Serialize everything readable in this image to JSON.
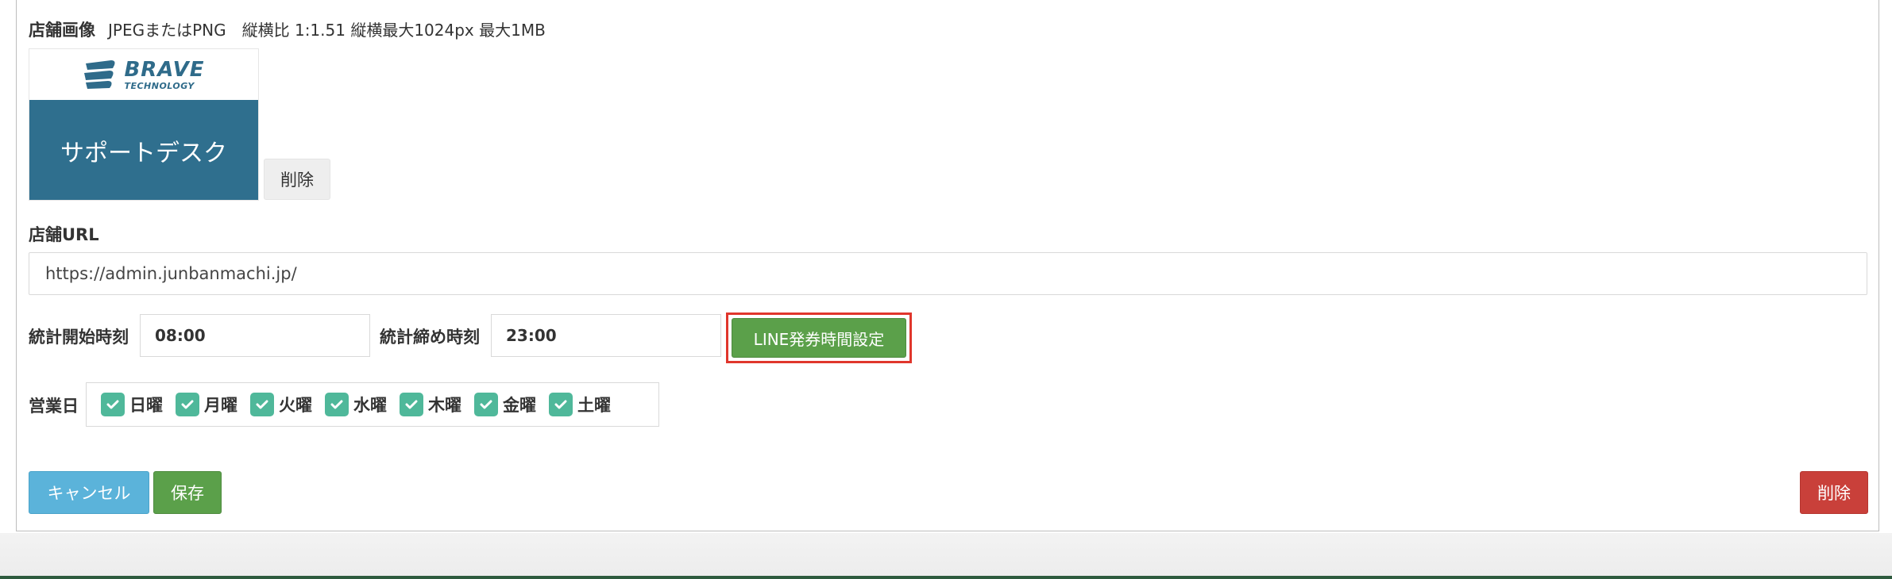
{
  "image_section": {
    "label": "店舗画像",
    "note": "JPEGまたはPNG　縦横比 1:1.51 縦横最大1024px 最大1MB",
    "logo_main": "BRAVE",
    "logo_sub": "TECHNOLOGY",
    "banner_text": "サポートデスク",
    "delete_label": "削除"
  },
  "url_section": {
    "label": "店舗URL",
    "value": "https://admin.junbanmachi.jp/"
  },
  "time_section": {
    "start_label": "統計開始時刻",
    "start_value": "08:00",
    "end_label": "統計締め時刻",
    "end_value": "23:00",
    "line_button_label": "LINE発券時間設定"
  },
  "days_section": {
    "label": "営業日",
    "days": [
      {
        "label": "日曜",
        "checked": true
      },
      {
        "label": "月曜",
        "checked": true
      },
      {
        "label": "火曜",
        "checked": true
      },
      {
        "label": "水曜",
        "checked": true
      },
      {
        "label": "木曜",
        "checked": true
      },
      {
        "label": "金曜",
        "checked": true
      },
      {
        "label": "土曜",
        "checked": true
      }
    ]
  },
  "actions": {
    "cancel_label": "キャンセル",
    "save_label": "保存",
    "delete_label": "削除"
  },
  "colors": {
    "primary_green": "#5ba04a",
    "info_blue": "#5bb3da",
    "danger_red": "#c9403a",
    "checkbox_teal": "#4fb89a",
    "highlight_red": "#e0362c",
    "banner_blue": "#2f6f8e"
  }
}
